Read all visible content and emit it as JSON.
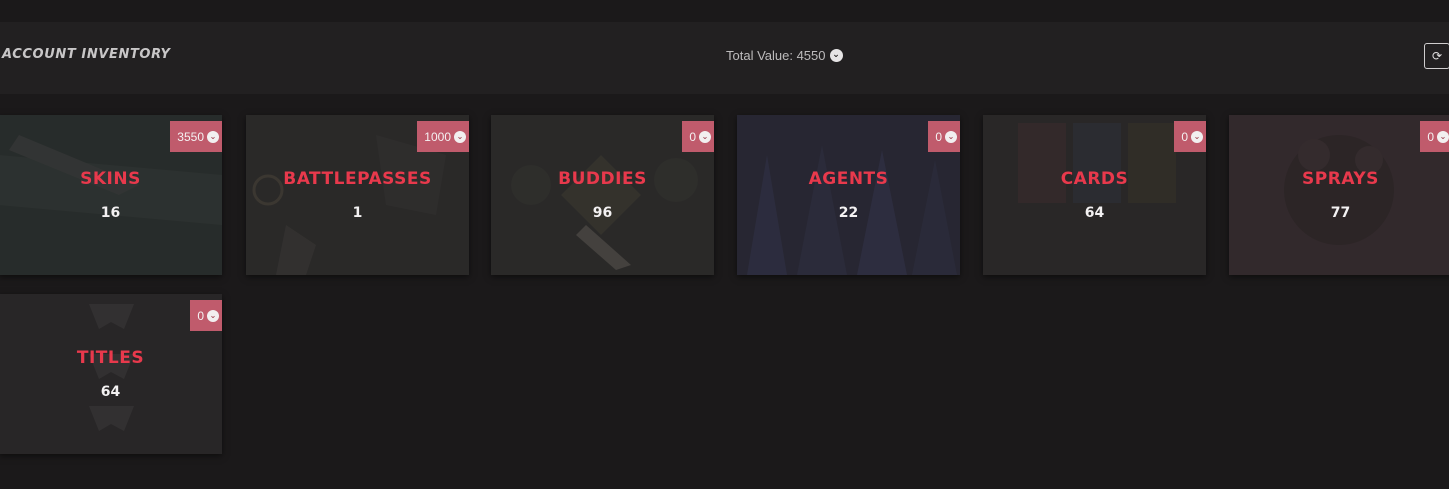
{
  "header": {
    "title": "ACCOUNT INVENTORY",
    "total_value_label": "Total Value: 4550",
    "currency_icon": "valorant-points-icon",
    "refresh_icon": "refresh-icon"
  },
  "colors": {
    "background": "#1b191a",
    "header_bg": "#222021",
    "accent_red": "#e8394c",
    "badge_bg": "#c05b6c"
  },
  "cards": [
    {
      "name": "SKINS",
      "count": "16",
      "value": "3550"
    },
    {
      "name": "BATTLEPASSES",
      "count": "1",
      "value": "1000"
    },
    {
      "name": "BUDDIES",
      "count": "96",
      "value": "0"
    },
    {
      "name": "AGENTS",
      "count": "22",
      "value": "0"
    },
    {
      "name": "CARDS",
      "count": "64",
      "value": "0"
    },
    {
      "name": "SPRAYS",
      "count": "77",
      "value": "0"
    },
    {
      "name": "TITLES",
      "count": "64",
      "value": "0"
    }
  ]
}
